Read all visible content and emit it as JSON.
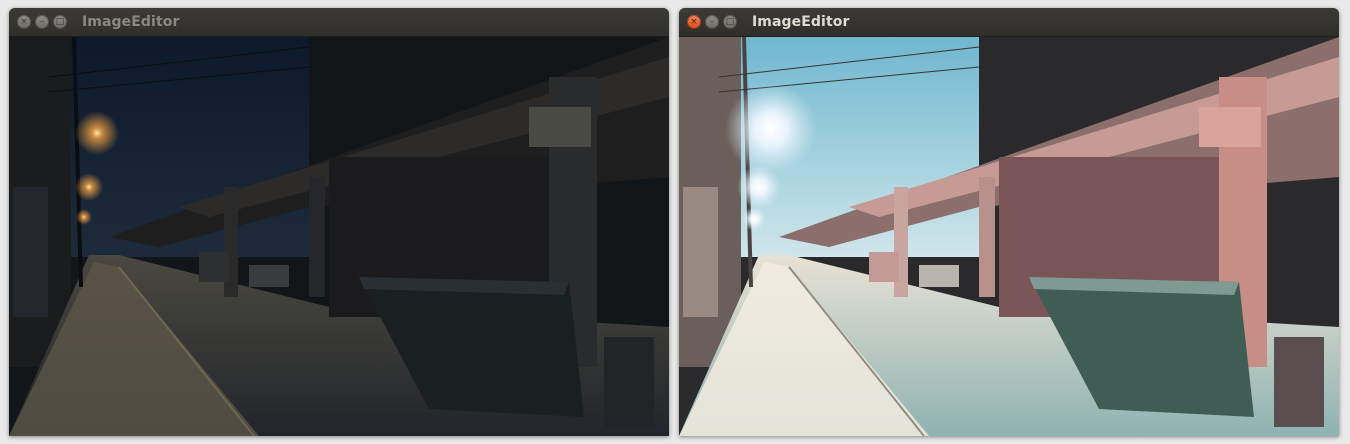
{
  "windows": [
    {
      "title": "ImageEditor",
      "state": "inactive",
      "controls": {
        "close_icon": "×",
        "minimize_icon": "–",
        "maximize_icon": "□"
      },
      "image": {
        "content": "night alley under elevated train tracks",
        "variant": "original dark"
      }
    },
    {
      "title": "ImageEditor",
      "state": "active",
      "controls": {
        "close_icon": "×",
        "minimize_icon": "–",
        "maximize_icon": "□"
      },
      "image": {
        "content": "night alley under elevated train tracks",
        "variant": "brightened / enhanced"
      }
    }
  ],
  "colors": {
    "titlebar": "#3c3b37",
    "close_active": "#dd4814",
    "title_active": "#dfdbd2",
    "title_inactive": "#8a8883",
    "desktop": "#e9e9e9"
  }
}
